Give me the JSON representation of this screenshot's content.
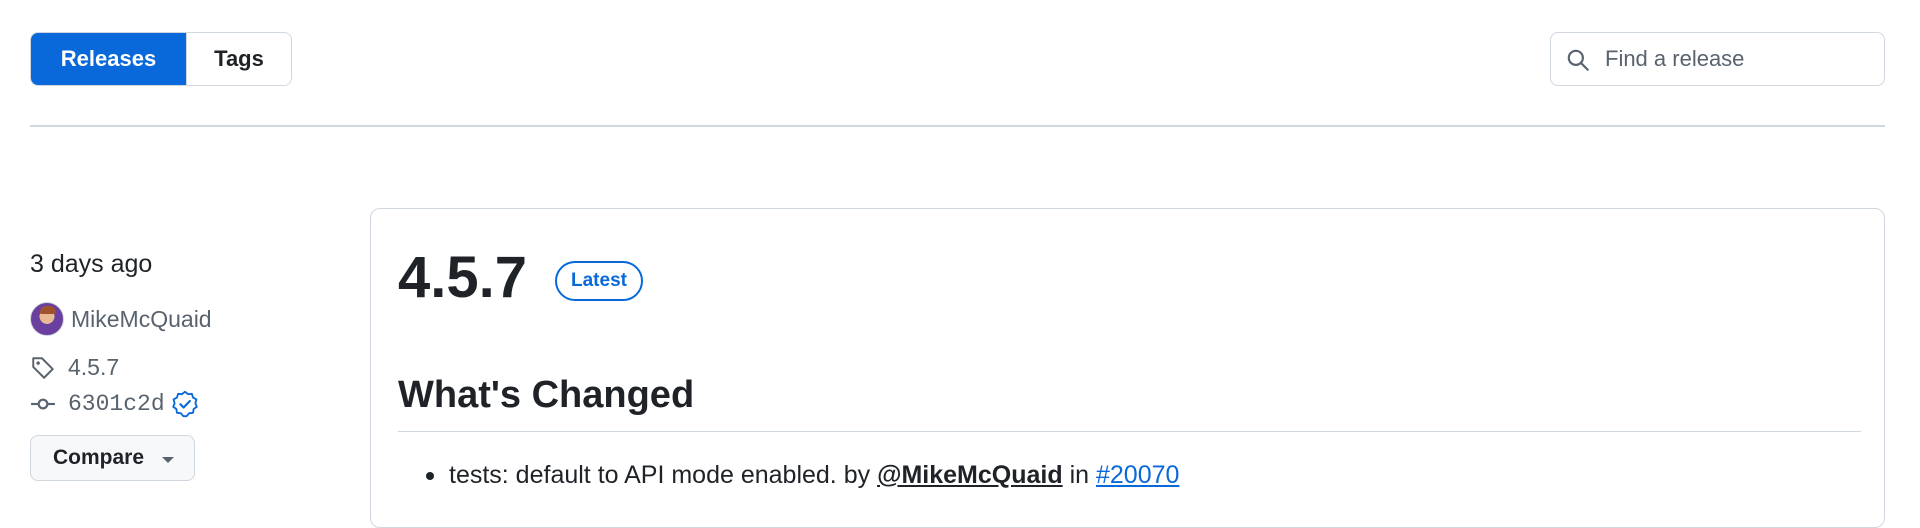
{
  "nav": {
    "tabs": [
      {
        "label": "Releases",
        "active": true
      },
      {
        "label": "Tags",
        "active": false
      }
    ]
  },
  "search": {
    "placeholder": "Find a release",
    "value": ""
  },
  "release": {
    "published": "3 days ago",
    "author": "MikeMcQuaid",
    "tag": "4.5.7",
    "commit": "6301c2d",
    "commit_verified": true,
    "compare_label": "Compare",
    "version": "4.5.7",
    "badge": "Latest",
    "section_title": "What's Changed",
    "changes": [
      {
        "text": "tests: default to API mode enabled.",
        "by_word": "by",
        "user": "@MikeMcQuaid",
        "in_word": "in",
        "pr": "#20070"
      }
    ]
  },
  "colors": {
    "accent": "#0969da",
    "text": "#1f2328",
    "muted": "#59636e",
    "border": "#d0d7de"
  },
  "icons": {
    "search": "search-icon",
    "tag": "tag-icon",
    "commit": "git-commit-icon",
    "verified": "verified-icon",
    "caret": "triangle-down-icon"
  }
}
